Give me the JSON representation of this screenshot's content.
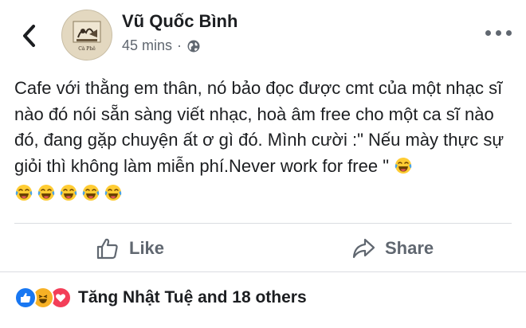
{
  "header": {
    "author_name": "Vũ Quốc Bình",
    "timestamp": "45 mins",
    "separator": "·",
    "privacy_icon": "globe-icon",
    "back_icon": "chevron-left-icon",
    "more_icon": "more-horizontal-icon",
    "avatar_caption": "Cà Phê"
  },
  "post": {
    "text": "Cafe với thằng em thân, nó bảo đọc được cmt của một nhạc sĩ nào đó nói sẵn sàng viết nhạc, hoà âm free cho một ca sĩ nào đó, đang gặp chuyện ất ơ gì đó. Mình cười :\" Nếu mày thực sự giỏi thì không làm miễn phí.Never work for free \"",
    "trailing_emoji": "laughing-tears-emoji",
    "trailing_emoji_count": 6
  },
  "actions": {
    "like_label": "Like",
    "like_icon": "thumbs-up-icon",
    "share_label": "Share",
    "share_icon": "share-icon"
  },
  "reactions": {
    "icons": [
      "like-reaction-icon",
      "haha-reaction-icon",
      "love-reaction-icon"
    ],
    "summary": "Tăng Nhật Tuệ and 18 others",
    "colors": {
      "like": "#1877f2",
      "haha": "#f7b125",
      "love": "#f33e58"
    }
  },
  "colors": {
    "text": "#1c1e21",
    "secondary": "#606770",
    "divider": "#dadde1"
  }
}
